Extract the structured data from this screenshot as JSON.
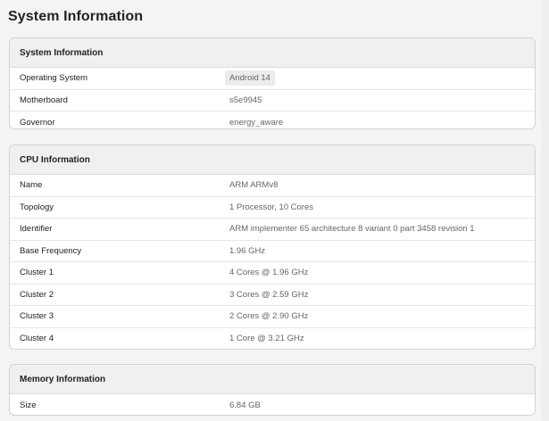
{
  "page": {
    "title": "System Information"
  },
  "system": {
    "header": "System Information",
    "rows": [
      {
        "key": "Operating System",
        "value": "Android 14"
      },
      {
        "key": "Motherboard",
        "value": "s5e9945"
      },
      {
        "key": "Governor",
        "value": "energy_aware"
      }
    ]
  },
  "cpu": {
    "header": "CPU Information",
    "rows": [
      {
        "key": "Name",
        "value": "ARM ARMv8"
      },
      {
        "key": "Topology",
        "value": "1 Processor, 10 Cores"
      },
      {
        "key": "Identifier",
        "value": "ARM implementer 65 architecture 8 variant 0 part 3458 revision 1"
      },
      {
        "key": "Base Frequency",
        "value": "1.96 GHz"
      },
      {
        "key": "Cluster 1",
        "value": "4 Cores @ 1.96 GHz"
      },
      {
        "key": "Cluster 2",
        "value": "3 Cores @ 2.59 GHz"
      },
      {
        "key": "Cluster 3",
        "value": "2 Cores @ 2.90 GHz"
      },
      {
        "key": "Cluster 4",
        "value": "1 Core @ 3.21 GHz"
      }
    ]
  },
  "memory": {
    "header": "Memory Information",
    "rows": [
      {
        "key": "Size",
        "value": "6.84 GB"
      }
    ]
  }
}
